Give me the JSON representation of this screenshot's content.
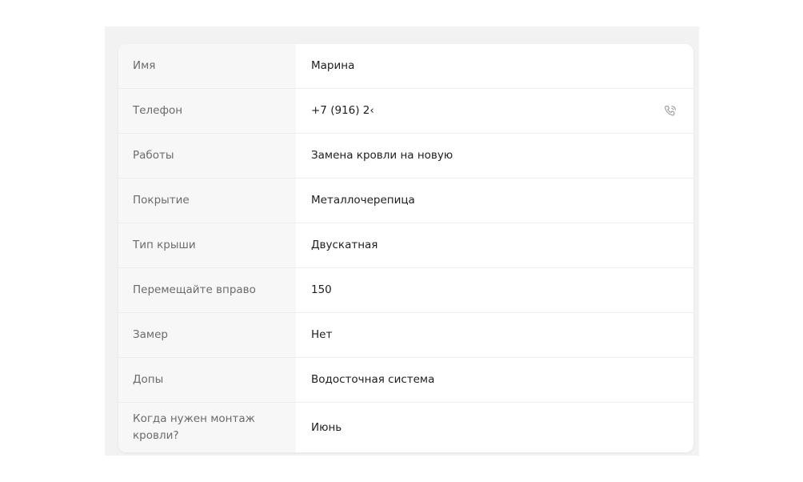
{
  "rows": [
    {
      "label": "Имя",
      "value": "Марина"
    },
    {
      "label": "Телефон",
      "value": "+7 (916) 2‹",
      "action_icon": "phone-call-icon"
    },
    {
      "label": "Работы",
      "value": "Замена кровли на новую"
    },
    {
      "label": "Покрытие",
      "value": "Металлочерепица"
    },
    {
      "label": "Тип крыши",
      "value": "Двускатная"
    },
    {
      "label": "Перемещайте вправо",
      "value": "150"
    },
    {
      "label": "Замер",
      "value": "Нет"
    },
    {
      "label": "Допы",
      "value": "Водосточная система"
    },
    {
      "label": "Когда нужен монтаж кровли?",
      "value": "Июнь"
    }
  ],
  "colors": {
    "page_bg": "#ffffff",
    "panel_bg": "#f2f2f2",
    "label_col_bg": "#f7f7f7",
    "label_text": "#6b6b6b",
    "value_text": "#1e1e1e",
    "divider": "#ececec",
    "icon": "#9a9a9a"
  }
}
